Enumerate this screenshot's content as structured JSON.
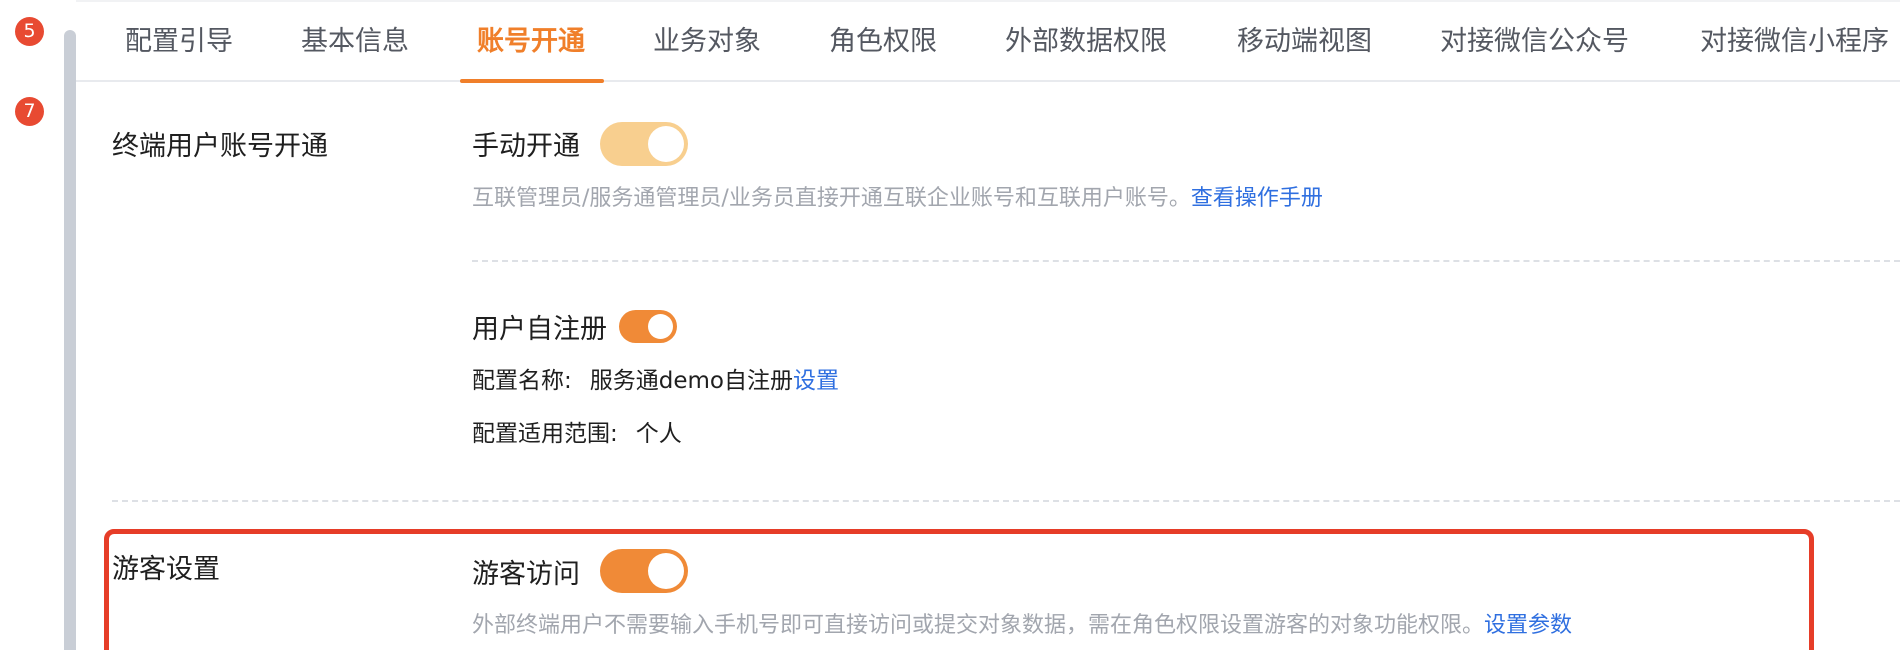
{
  "steps": {
    "badge_a": "5",
    "badge_b": "7"
  },
  "tabs": [
    {
      "label": "配置引导"
    },
    {
      "label": "基本信息"
    },
    {
      "label": "账号开通",
      "active": true
    },
    {
      "label": "业务对象"
    },
    {
      "label": "角色权限"
    },
    {
      "label": "外部数据权限"
    },
    {
      "label": "移动端视图"
    },
    {
      "label": "对接微信公众号"
    },
    {
      "label": "对接微信小程序"
    }
  ],
  "account_section": {
    "label": "终端用户账号开通",
    "manual": {
      "title": "手动开通",
      "enabled": true,
      "disabled_look": true,
      "desc": "互联管理员/服务通管理员/业务员直接开通互联企业账号和互联用户账号。",
      "link": "查看操作手册"
    },
    "self_register": {
      "title": "用户自注册",
      "enabled": true,
      "config_name_label": "配置名称:",
      "config_name_value": "服务通demo自注册",
      "config_name_link": "设置",
      "scope_label": "配置适用范围:",
      "scope_value": "个人"
    }
  },
  "guest_section": {
    "label": "游客设置",
    "visit": {
      "title": "游客访问",
      "enabled": true,
      "desc": "外部终端用户不需要输入手机号即可直接访问或提交对象数据，需在角色权限设置游客的对象功能权限。",
      "link": "设置参数"
    }
  },
  "colors": {
    "accent": "#f07f2a",
    "toggle_on": "#f08a37",
    "toggle_disabled": "#f8cf8f",
    "link": "#2f6fe0",
    "highlight": "#e63d28",
    "badge": "#e84a32"
  }
}
